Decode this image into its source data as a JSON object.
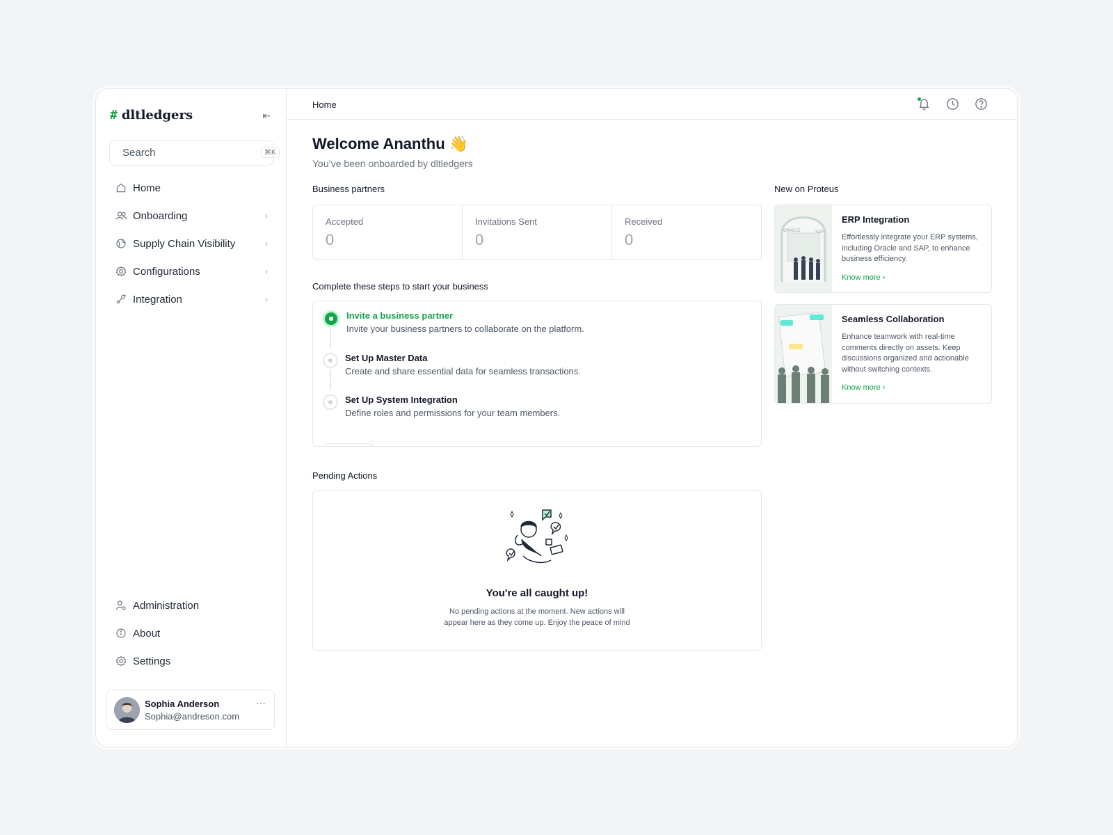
{
  "brand": {
    "name": "dltledgers",
    "mark": "#"
  },
  "search": {
    "placeholder": "Search",
    "shortcut": "⌘K"
  },
  "nav": {
    "items": [
      {
        "label": "Home",
        "icon": "home-icon"
      },
      {
        "label": "Onboarding",
        "icon": "users-icon"
      },
      {
        "label": "Supply Chain Visibility",
        "icon": "globe-icon"
      },
      {
        "label": "Configurations",
        "icon": "gear-badge-icon"
      },
      {
        "label": "Integration",
        "icon": "plug-icon"
      }
    ],
    "bottom": [
      {
        "label": "Administration",
        "icon": "user-gear-icon"
      },
      {
        "label": "About",
        "icon": "info-icon"
      },
      {
        "label": "Settings",
        "icon": "settings-icon"
      }
    ]
  },
  "user": {
    "name": "Sophia Anderson",
    "email": "Sophia@andreson.com"
  },
  "topbar": {
    "breadcrumb": "Home"
  },
  "welcome": {
    "title": "Welcome Ananthu 👋",
    "subtitle": "You’ve been onboarded by dltledgers"
  },
  "partners": {
    "label": "Business partners",
    "stats": [
      {
        "label": "Accepted",
        "value": "0"
      },
      {
        "label": "Invitations Sent",
        "value": "0"
      },
      {
        "label": "Received",
        "value": "0"
      }
    ]
  },
  "steps": {
    "label": "Complete these steps to start your business",
    "items": [
      {
        "title": "Invite a business partner",
        "desc": "Invite your business partners to collaborate on the platform."
      },
      {
        "title": "Set Up Master Data",
        "desc": "Create and share essential data for seamless transactions."
      },
      {
        "title": "Set Up System Integration",
        "desc": "Define roles and permissions for your team members."
      }
    ]
  },
  "pending": {
    "label": "Pending Actions",
    "title": "You're all caught up!",
    "desc": "No pending actions at the moment. New actions will appear here as they come up. Enjoy the peace of mind"
  },
  "news": {
    "label": "New on Proteus",
    "cards": [
      {
        "title": "ERP Integration",
        "desc": "Effortlessly integrate your ERP systems, including Oracle and SAP, to enhance business efficiency.",
        "link": "Know more  ›"
      },
      {
        "title": "Seamless Collaboration",
        "desc": "Enhance teamwork with real-time comments directly on assets. Keep discussions organized and actionable without switching contexts.",
        "link": "Know more  ›"
      }
    ]
  },
  "colors": {
    "accent": "#16a34a",
    "border": "#e5e7eb",
    "background": "#f3f4f6"
  }
}
